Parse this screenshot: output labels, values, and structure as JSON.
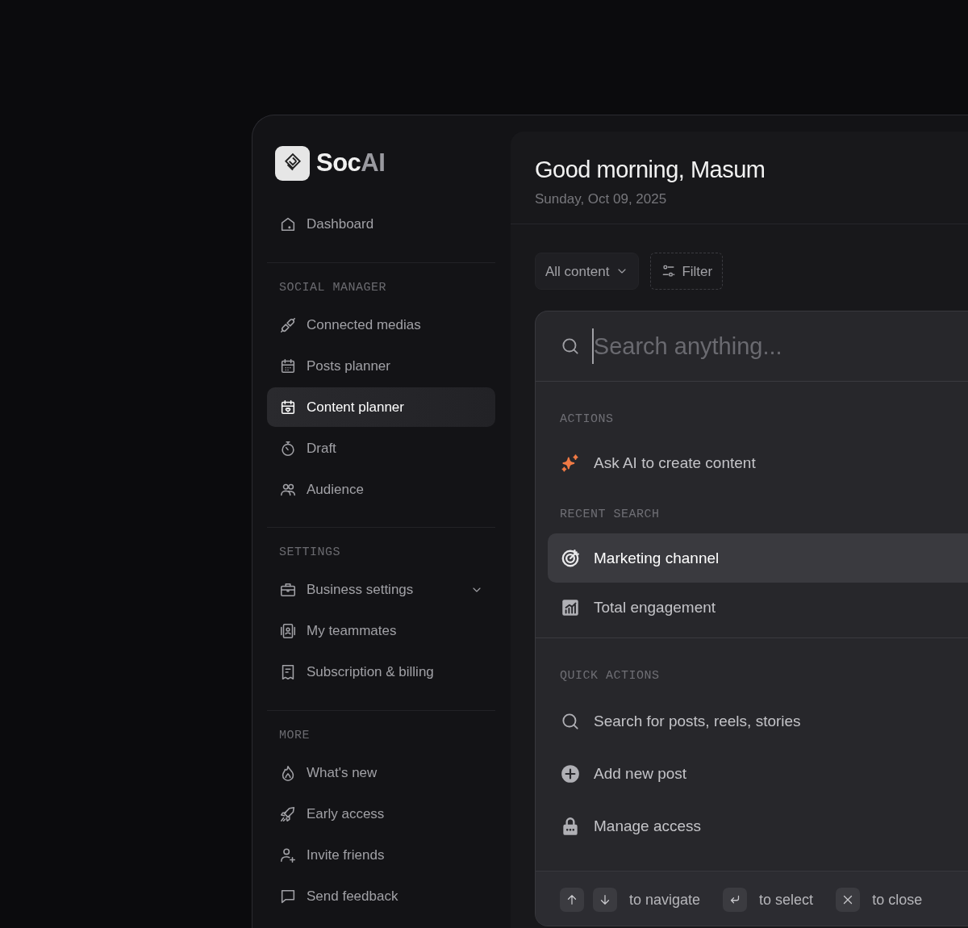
{
  "brand": {
    "text": "Soc",
    "accent": "AI"
  },
  "sidebar": {
    "sections": [
      {
        "items": [
          {
            "label": "Dashboard",
            "kind": "link",
            "selected": false
          }
        ]
      },
      {
        "title": "SOCIAL MANAGER",
        "items": [
          {
            "label": "Connected medias",
            "kind": "link",
            "selected": false
          },
          {
            "label": "Posts planner",
            "kind": "link",
            "selected": false
          },
          {
            "label": "Content planner",
            "kind": "link",
            "selected": true
          },
          {
            "label": "Draft",
            "kind": "link",
            "selected": false
          },
          {
            "label": "Audience",
            "kind": "link",
            "selected": false
          }
        ]
      },
      {
        "title": "SETTINGS",
        "items": [
          {
            "label": "Business settings",
            "kind": "group",
            "selected": false
          },
          {
            "label": "My teammates",
            "kind": "link",
            "selected": false
          },
          {
            "label": "Subscription & billing",
            "kind": "link",
            "selected": false
          }
        ]
      },
      {
        "title": "MORE",
        "items": [
          {
            "label": "What's new",
            "kind": "link",
            "selected": false
          },
          {
            "label": "Early access",
            "kind": "link",
            "selected": false
          },
          {
            "label": "Invite friends",
            "kind": "link",
            "selected": false
          },
          {
            "label": "Send feedback",
            "kind": "link",
            "selected": false
          }
        ]
      }
    ]
  },
  "header": {
    "title": "Good morning, Masum",
    "date": "Sunday, Oct 09, 2025"
  },
  "toolbar": {
    "content_select": "All content",
    "filter_button": "Filter"
  },
  "command_palette": {
    "search": {
      "placeholder": "Search anything..."
    },
    "groups": [
      {
        "title": "ACTIONS",
        "separated": false,
        "items": [
          {
            "label": "Ask AI to create content",
            "selected": false
          }
        ]
      },
      {
        "title": "RECENT SEARCH",
        "separated": false,
        "items": [
          {
            "label": "Marketing channel",
            "selected": true
          },
          {
            "label": "Total engagement",
            "selected": false
          }
        ]
      },
      {
        "title": "QUICK ACTIONS",
        "separated": true,
        "items": [
          {
            "label": "Search for posts, reels, stories",
            "selected": false
          },
          {
            "label": "Add new post",
            "selected": false
          },
          {
            "label": "Manage access",
            "selected": false
          }
        ]
      }
    ],
    "footer_hints": [
      {
        "label": "to navigate"
      },
      {
        "label": "to select"
      },
      {
        "label": "to close"
      }
    ]
  }
}
